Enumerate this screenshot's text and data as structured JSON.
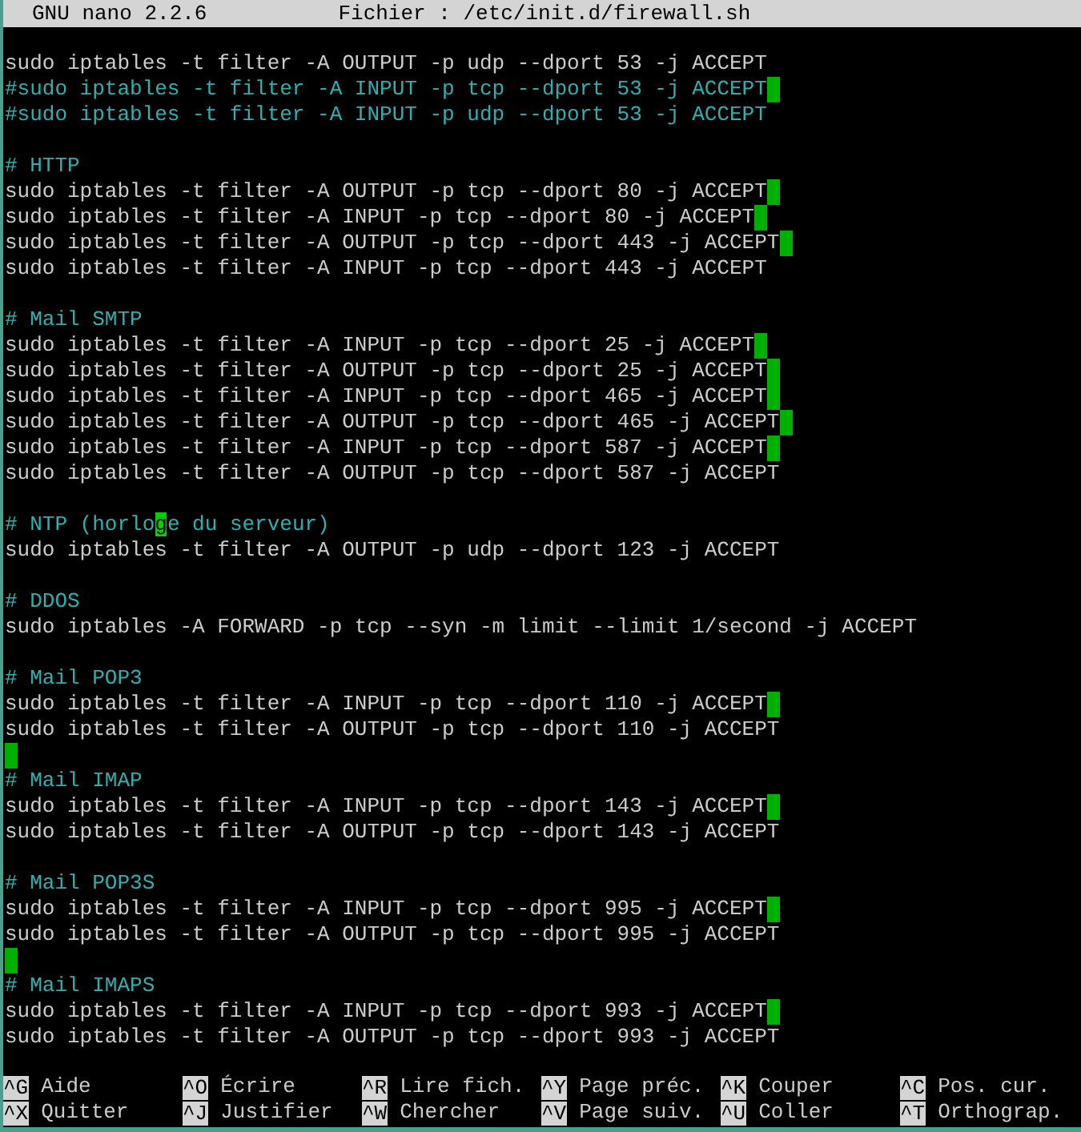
{
  "title_bar": {
    "version": "GNU nano 2.2.6",
    "file": "Fichier : /etc/init.d/firewall.sh"
  },
  "lines": [
    {
      "kind": "code",
      "text": "sudo iptables -t filter -A OUTPUT -p udp --dport 53 -j ACCEPT",
      "trailing_whitespace": false
    },
    {
      "kind": "comment",
      "text": "#sudo iptables -t filter -A INPUT -p tcp --dport 53 -j ACCEPT",
      "trailing_whitespace": true
    },
    {
      "kind": "comment",
      "text": "#sudo iptables -t filter -A INPUT -p udp --dport 53 -j ACCEPT",
      "trailing_whitespace": false
    },
    {
      "kind": "blank",
      "trailing_whitespace": false
    },
    {
      "kind": "comment",
      "text": "# HTTP",
      "trailing_whitespace": false
    },
    {
      "kind": "code",
      "text": "sudo iptables -t filter -A OUTPUT -p tcp --dport 80 -j ACCEPT",
      "trailing_whitespace": true
    },
    {
      "kind": "code",
      "text": "sudo iptables -t filter -A INPUT -p tcp --dport 80 -j ACCEPT",
      "trailing_whitespace": true
    },
    {
      "kind": "code",
      "text": "sudo iptables -t filter -A OUTPUT -p tcp --dport 443 -j ACCEPT",
      "trailing_whitespace": true
    },
    {
      "kind": "code",
      "text": "sudo iptables -t filter -A INPUT -p tcp --dport 443 -j ACCEPT",
      "trailing_whitespace": false
    },
    {
      "kind": "blank",
      "trailing_whitespace": false
    },
    {
      "kind": "comment",
      "text": "# Mail SMTP",
      "trailing_whitespace": false
    },
    {
      "kind": "code",
      "text": "sudo iptables -t filter -A INPUT -p tcp --dport 25 -j ACCEPT",
      "trailing_whitespace": true
    },
    {
      "kind": "code",
      "text": "sudo iptables -t filter -A OUTPUT -p tcp --dport 25 -j ACCEPT",
      "trailing_whitespace": true
    },
    {
      "kind": "code",
      "text": "sudo iptables -t filter -A INPUT -p tcp --dport 465 -j ACCEPT",
      "trailing_whitespace": true
    },
    {
      "kind": "code",
      "text": "sudo iptables -t filter -A OUTPUT -p tcp --dport 465 -j ACCEPT",
      "trailing_whitespace": true
    },
    {
      "kind": "code",
      "text": "sudo iptables -t filter -A INPUT -p tcp --dport 587 -j ACCEPT",
      "trailing_whitespace": true
    },
    {
      "kind": "code",
      "text": "sudo iptables -t filter -A OUTPUT -p tcp --dport 587 -j ACCEPT",
      "trailing_whitespace": false
    },
    {
      "kind": "blank",
      "trailing_whitespace": false
    },
    {
      "kind": "comment",
      "text": "# NTP (horlo",
      "cursor_char": "g",
      "text_after": "e du serveur)",
      "trailing_whitespace": false
    },
    {
      "kind": "code",
      "text": "sudo iptables -t filter -A OUTPUT -p udp --dport 123 -j ACCEPT",
      "trailing_whitespace": false
    },
    {
      "kind": "blank",
      "trailing_whitespace": false
    },
    {
      "kind": "comment",
      "text": "# DDOS",
      "trailing_whitespace": false
    },
    {
      "kind": "code",
      "text": "sudo iptables -A FORWARD -p tcp --syn -m limit --limit 1/second -j ACCEPT",
      "trailing_whitespace": false
    },
    {
      "kind": "blank",
      "trailing_whitespace": false
    },
    {
      "kind": "comment",
      "text": "# Mail POP3",
      "trailing_whitespace": false
    },
    {
      "kind": "code",
      "text": "sudo iptables -t filter -A INPUT -p tcp --dport 110 -j ACCEPT",
      "trailing_whitespace": true
    },
    {
      "kind": "code",
      "text": "sudo iptables -t filter -A OUTPUT -p tcp --dport 110 -j ACCEPT",
      "trailing_whitespace": false
    },
    {
      "kind": "blank",
      "trailing_whitespace": true
    },
    {
      "kind": "comment",
      "text": "# Mail IMAP",
      "trailing_whitespace": false
    },
    {
      "kind": "code",
      "text": "sudo iptables -t filter -A INPUT -p tcp --dport 143 -j ACCEPT",
      "trailing_whitespace": true
    },
    {
      "kind": "code",
      "text": "sudo iptables -t filter -A OUTPUT -p tcp --dport 143 -j ACCEPT",
      "trailing_whitespace": false
    },
    {
      "kind": "blank",
      "trailing_whitespace": false
    },
    {
      "kind": "comment",
      "text": "# Mail POP3S",
      "trailing_whitespace": false
    },
    {
      "kind": "code",
      "text": "sudo iptables -t filter -A INPUT -p tcp --dport 995 -j ACCEPT",
      "trailing_whitespace": true
    },
    {
      "kind": "code",
      "text": "sudo iptables -t filter -A OUTPUT -p tcp --dport 995 -j ACCEPT",
      "trailing_whitespace": false
    },
    {
      "kind": "blank",
      "trailing_whitespace": true
    },
    {
      "kind": "comment",
      "text": "# Mail IMAPS",
      "trailing_whitespace": false
    },
    {
      "kind": "code",
      "text": "sudo iptables -t filter -A INPUT -p tcp --dport 993 -j ACCEPT",
      "trailing_whitespace": true
    },
    {
      "kind": "code",
      "text": "sudo iptables -t filter -A OUTPUT -p tcp --dport 993 -j ACCEPT",
      "trailing_whitespace": false
    }
  ],
  "shortcuts": [
    [
      {
        "key": "^G",
        "label": "Aide"
      },
      {
        "key": "^O",
        "label": "Écrire"
      },
      {
        "key": "^R",
        "label": "Lire fich."
      },
      {
        "key": "^Y",
        "label": "Page préc."
      },
      {
        "key": "^K",
        "label": "Couper"
      },
      {
        "key": "^C",
        "label": "Pos. cur."
      }
    ],
    [
      {
        "key": "^X",
        "label": "Quitter"
      },
      {
        "key": "^J",
        "label": "Justifier"
      },
      {
        "key": "^W",
        "label": "Chercher"
      },
      {
        "key": "^V",
        "label": "Page suiv."
      },
      {
        "key": "^U",
        "label": "Coller"
      },
      {
        "key": "^T",
        "label": "Orthograp."
      }
    ]
  ]
}
